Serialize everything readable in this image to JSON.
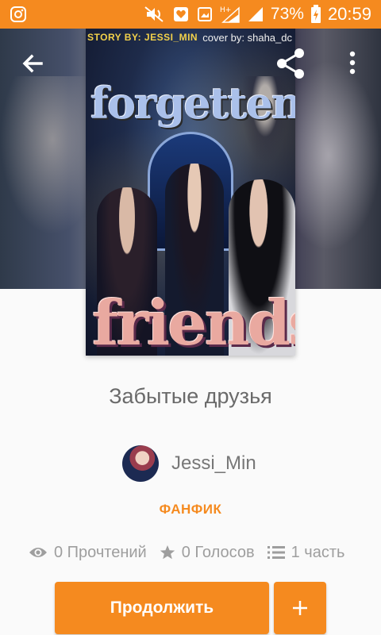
{
  "status_bar": {
    "battery_percent": "73%",
    "time": "20:59",
    "icons": [
      "instagram-icon",
      "mute-icon",
      "heart-notification-icon",
      "screenshot-icon",
      "network-h-plus-icon",
      "signal-icon",
      "battery-charging-icon"
    ]
  },
  "toolbar": {
    "back_icon": "arrow-left-icon",
    "share_icon": "share-icon",
    "more_icon": "more-vertical-icon"
  },
  "cover": {
    "credit_left": "STORY BY: JESSI_MIN",
    "credit_right": "cover by: shaha_dc",
    "title_word_1": "forgetten",
    "title_word_2": "friends"
  },
  "story": {
    "title": "Забытые друзья",
    "author": "Jessi_Min",
    "category": "ФАНФИК"
  },
  "stats": {
    "reads": "0 Прочтений",
    "votes": "0 Голосов",
    "parts": "1 часть"
  },
  "actions": {
    "continue_label": "Продолжить",
    "add_label": "+"
  },
  "colors": {
    "accent": "#f58a1f",
    "text_secondary": "#9e9e9e"
  }
}
